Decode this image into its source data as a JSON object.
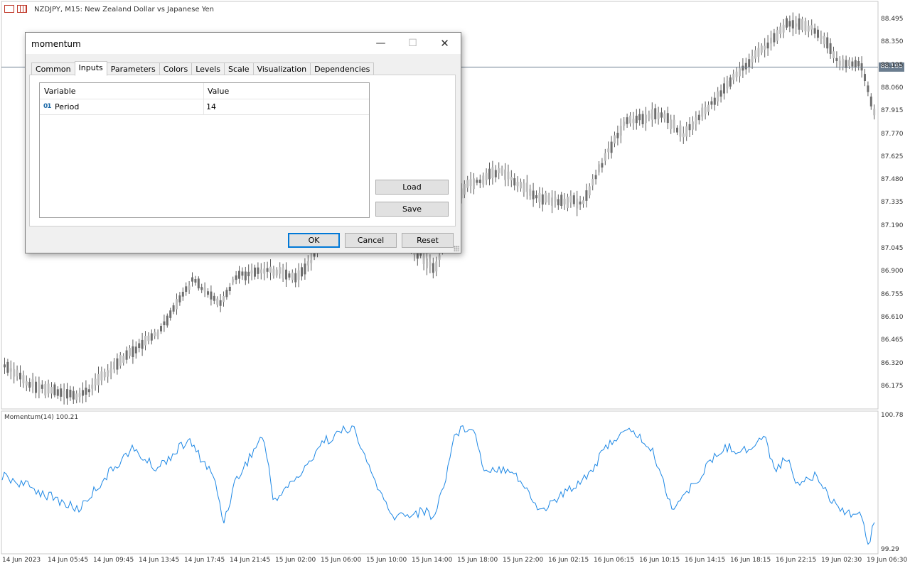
{
  "chart": {
    "symbol_title": "NZDJPY, M15:  New Zealand Dollar vs Japanese Yen",
    "current_price": "88.195",
    "price_labels": [
      "88.495",
      "88.350",
      "88.195",
      "88.060",
      "87.915",
      "87.770",
      "87.625",
      "87.480",
      "87.335",
      "87.190",
      "87.045",
      "86.900",
      "86.755",
      "86.610",
      "86.465",
      "86.320",
      "86.175"
    ],
    "time_labels": [
      "14 Jun 2023",
      "14 Jun 05:45",
      "14 Jun 09:45",
      "14 Jun 13:45",
      "14 Jun 17:45",
      "14 Jun 21:45",
      "15 Jun 02:00",
      "15 Jun 06:00",
      "15 Jun 10:00",
      "15 Jun 14:00",
      "15 Jun 18:00",
      "15 Jun 22:00",
      "16 Jun 02:15",
      "16 Jun 06:15",
      "16 Jun 10:15",
      "16 Jun 14:15",
      "16 Jun 18:15",
      "16 Jun 22:15",
      "19 Jun 02:30",
      "19 Jun 06:30"
    ],
    "indicator_title": "Momentum(14) 100.21",
    "indicator_max": "100.78",
    "indicator_min": "99.29",
    "colors": {
      "candle": "#9e9e9e",
      "momentum_line": "#1e88e5",
      "price_line": "#6b7d8f"
    }
  },
  "dialog": {
    "title": "momentum",
    "controls": {
      "minimize": "—",
      "maximize": "☐",
      "close": "✕"
    },
    "tabs": [
      "Common",
      "Inputs",
      "Parameters",
      "Colors",
      "Levels",
      "Scale",
      "Visualization",
      "Dependencies"
    ],
    "active_tab": "Inputs",
    "grid": {
      "headers": {
        "variable": "Variable",
        "value": "Value"
      },
      "rows": [
        {
          "icon": "01",
          "variable": "Period",
          "value": "14"
        }
      ]
    },
    "buttons": {
      "load": "Load",
      "save": "Save",
      "ok": "OK",
      "cancel": "Cancel",
      "reset": "Reset"
    }
  }
}
